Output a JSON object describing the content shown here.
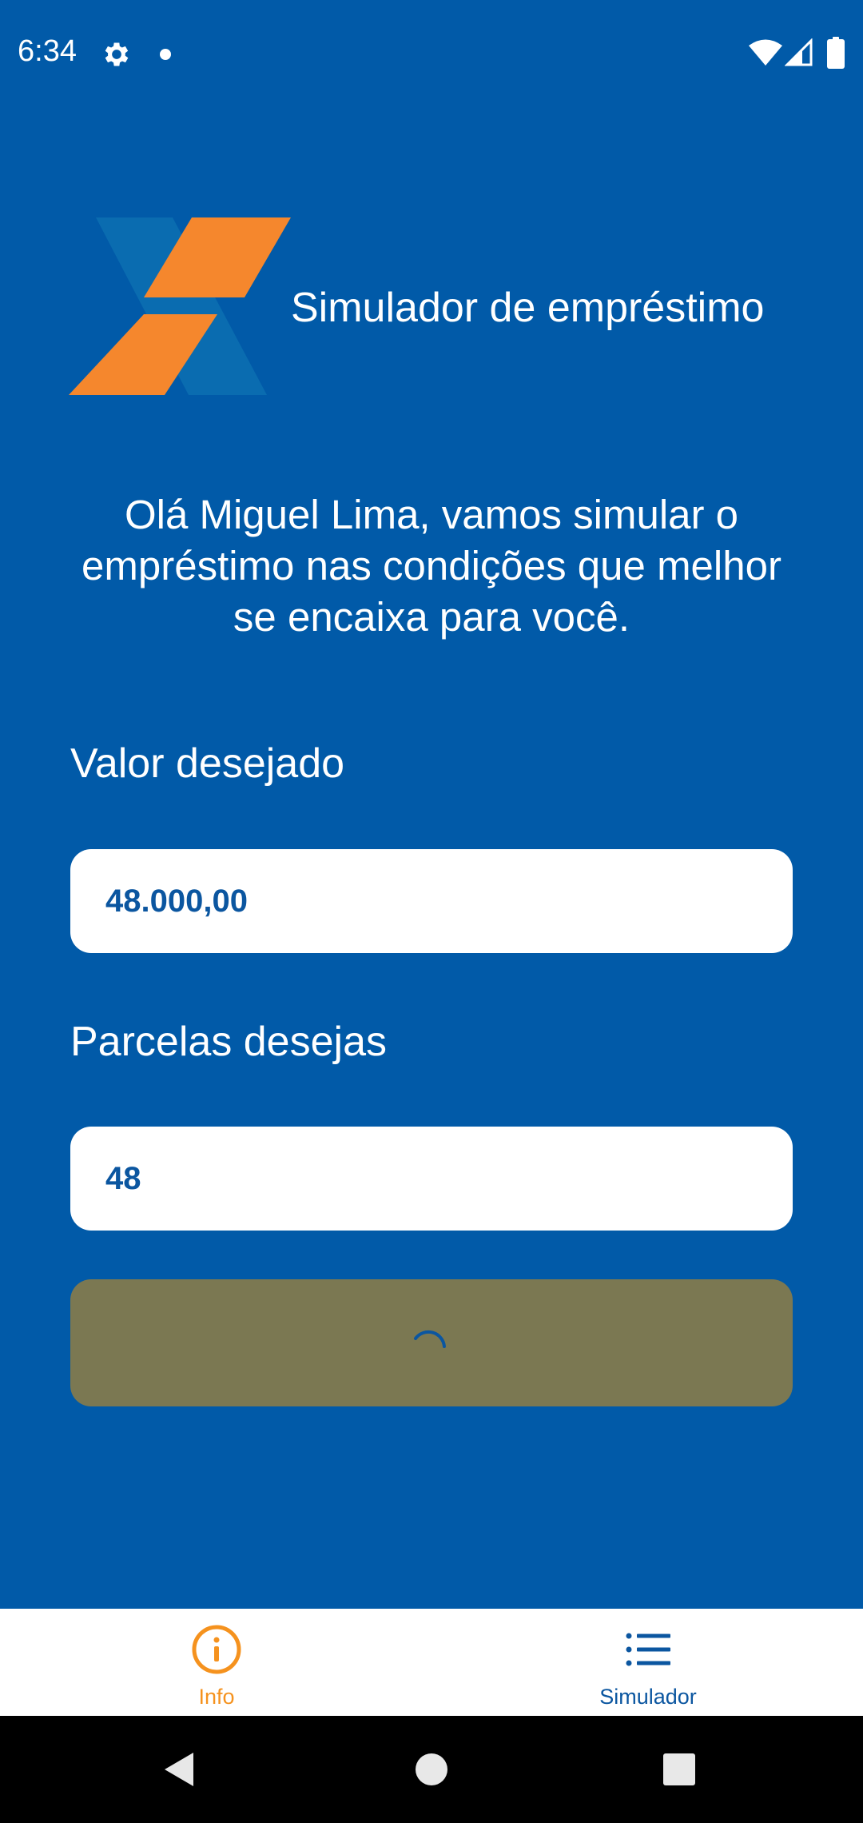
{
  "status_bar": {
    "time": "6:34",
    "icons": [
      "gear-icon",
      "notification-dot-icon",
      "wifi-icon",
      "signal-icon",
      "battery-icon"
    ]
  },
  "header": {
    "title": "Simulador de empréstimo",
    "logo": "caixa-x-logo"
  },
  "greeting": "Olá Miguel Lima, vamos simular o empréstimo nas condições que melhor se encaixa para você.",
  "form": {
    "valor_label": "Valor desejado",
    "valor_value": "48.000,00",
    "parcelas_label": "Parcelas desejas",
    "parcelas_value": "48",
    "submit_state": "loading"
  },
  "bottom_nav": {
    "items": [
      {
        "label": "Info",
        "icon": "info-icon",
        "active": true
      },
      {
        "label": "Simulador",
        "icon": "list-icon",
        "active": false
      }
    ]
  },
  "colors": {
    "background": "#015aa8",
    "accent_orange": "#f5921e",
    "button_loading": "#7b7852",
    "text_blue": "#0b56a0"
  }
}
